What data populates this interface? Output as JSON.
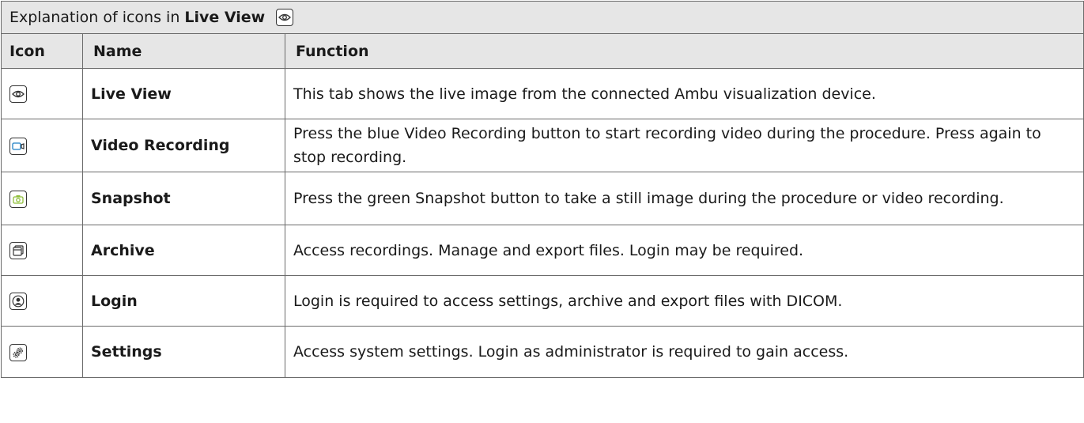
{
  "title": {
    "prefix": "Explanation of icons in ",
    "emphasis": "Live View",
    "icon": "eye-icon"
  },
  "columns": {
    "icon": "Icon",
    "name": "Name",
    "function": "Function"
  },
  "rows": [
    {
      "icon": "eye-icon",
      "name": "Live View",
      "function": "This tab shows the live image from the connected Ambu visualization device."
    },
    {
      "icon": "video-camera-icon",
      "icon_color": "#1f7fc4",
      "name": "Video Recording",
      "function": "Press the blue Video Recording button to start recording video during the procedure. Press again to stop recording."
    },
    {
      "icon": "camera-icon",
      "icon_color": "#8fbf3a",
      "name": "Snapshot",
      "function": "Press the green Snapshot button to take a still image during the procedure or video recording."
    },
    {
      "icon": "folder-icon",
      "name": "Archive",
      "function": "Access recordings. Manage and export files. Login may be required."
    },
    {
      "icon": "user-icon",
      "name": "Login",
      "function": "Login is required to access settings, archive and export files with DICOM."
    },
    {
      "icon": "gears-icon",
      "name": "Settings",
      "function": "Access system settings. Login as administrator is required to gain access."
    }
  ]
}
